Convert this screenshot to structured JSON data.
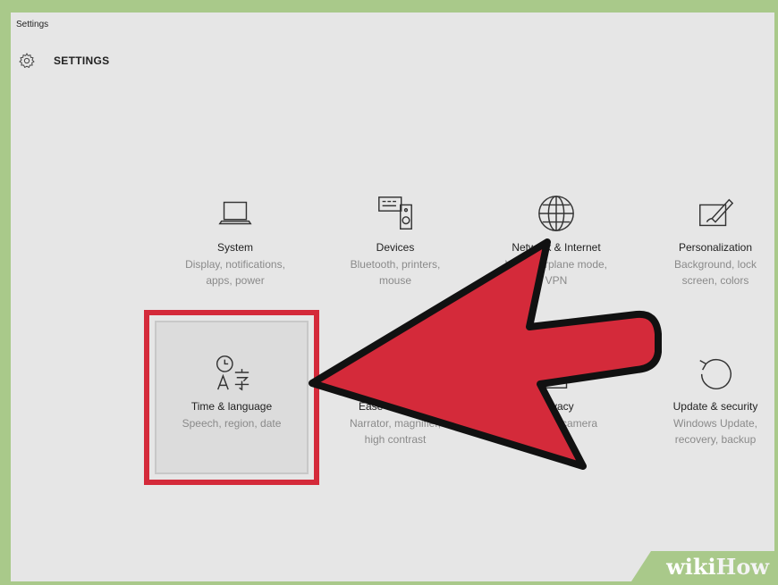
{
  "window": {
    "title": "Settings"
  },
  "header": {
    "title": "SETTINGS",
    "icon": "gear-icon"
  },
  "tiles": [
    {
      "name": "System",
      "desc1": "Display, notifications,",
      "desc2": "apps, power",
      "icon": "laptop-icon"
    },
    {
      "name": "Devices",
      "desc1": "Bluetooth, printers,",
      "desc2": "mouse",
      "icon": "devices-icon"
    },
    {
      "name": "Network & Internet",
      "desc1": "Wi-Fi, airplane mode,",
      "desc2": "VPN",
      "icon": "globe-icon"
    },
    {
      "name": "Personalization",
      "desc1": "Background, lock",
      "desc2": "screen, colors",
      "icon": "paintbrush-icon"
    },
    {
      "name": "Time & language",
      "desc1": "Speech, region, date",
      "desc2": "",
      "icon": "time-language-icon"
    },
    {
      "name": "Ease of Access",
      "desc1": "Narrator, magnifier,",
      "desc2": "high contrast",
      "icon": "ease-of-access-icon"
    },
    {
      "name": "Privacy",
      "desc1": "Location, camera",
      "desc2": "",
      "icon": "lock-icon"
    },
    {
      "name": "Update & security",
      "desc1": "Windows Update,",
      "desc2": "recovery, backup",
      "icon": "refresh-icon"
    }
  ],
  "annotation": {
    "arrow_color": "#d42a3a",
    "highlight_color": "#d42a3a"
  },
  "watermark": {
    "brand1": "wiki",
    "brand2": "How"
  }
}
